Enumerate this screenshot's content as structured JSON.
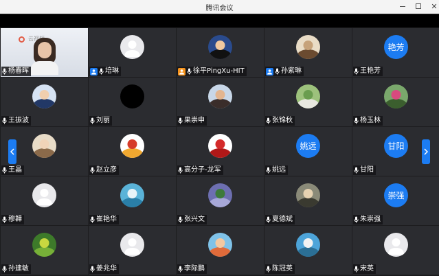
{
  "window": {
    "title": "腾讯会议"
  },
  "participants": [
    {
      "name": "杨春晖",
      "avatar": "video",
      "host": "none",
      "video_tag": "云视频"
    },
    {
      "name": "培琳",
      "avatar": "default",
      "host": "blue"
    },
    {
      "name": "徐平PingXu-HIT",
      "avatar": "photo-man",
      "host": "orange"
    },
    {
      "name": "孙紫琳",
      "avatar": "photo-dog",
      "host": "blue"
    },
    {
      "name": "王艳芳",
      "avatar": "text",
      "avatar_text": "艳芳",
      "host": "none"
    },
    {
      "name": "王振波",
      "avatar": "photo-man-blue",
      "host": "none"
    },
    {
      "name": "刘丽",
      "avatar": "black",
      "host": "none"
    },
    {
      "name": "果崇申",
      "avatar": "photo-portrait",
      "host": "none"
    },
    {
      "name": "张锦秋",
      "avatar": "photo-road",
      "host": "none"
    },
    {
      "name": "杨玉林",
      "avatar": "photo-outdoor",
      "host": "none"
    },
    {
      "name": "王晶",
      "avatar": "photo-girl",
      "host": "none"
    },
    {
      "name": "赵立彦",
      "avatar": "photo-logo",
      "host": "none"
    },
    {
      "name": "高分子-龙军",
      "avatar": "photo-dragon",
      "host": "none"
    },
    {
      "name": "姚远",
      "avatar": "text",
      "avatar_text": "姚远",
      "host": "none"
    },
    {
      "name": "甘阳",
      "avatar": "text",
      "avatar_text": "甘阳",
      "host": "none"
    },
    {
      "name": "穆韡",
      "avatar": "default",
      "host": "none"
    },
    {
      "name": "崔艳华",
      "avatar": "photo-sea",
      "host": "none"
    },
    {
      "name": "张兴文",
      "avatar": "photo-lavender",
      "host": "none"
    },
    {
      "name": "夏德斌",
      "avatar": "photo-people",
      "host": "none"
    },
    {
      "name": "朱崇强",
      "avatar": "text",
      "avatar_text": "崇强",
      "host": "none"
    },
    {
      "name": "孙建敏",
      "avatar": "photo-flower",
      "host": "none"
    },
    {
      "name": "姜兆华",
      "avatar": "default",
      "host": "none"
    },
    {
      "name": "李际鹏",
      "avatar": "photo-beach",
      "host": "none"
    },
    {
      "name": "陈冠英",
      "avatar": "photo-ocean",
      "host": "none"
    },
    {
      "name": "宋英",
      "avatar": "default",
      "host": "none"
    }
  ],
  "nav": {
    "prev_icon": "chevron-left-icon",
    "next_icon": "chevron-right-icon"
  },
  "colors": {
    "accent": "#1c7cf2",
    "host_orange": "#f7941d",
    "tile_bg": "#2b2c30"
  }
}
